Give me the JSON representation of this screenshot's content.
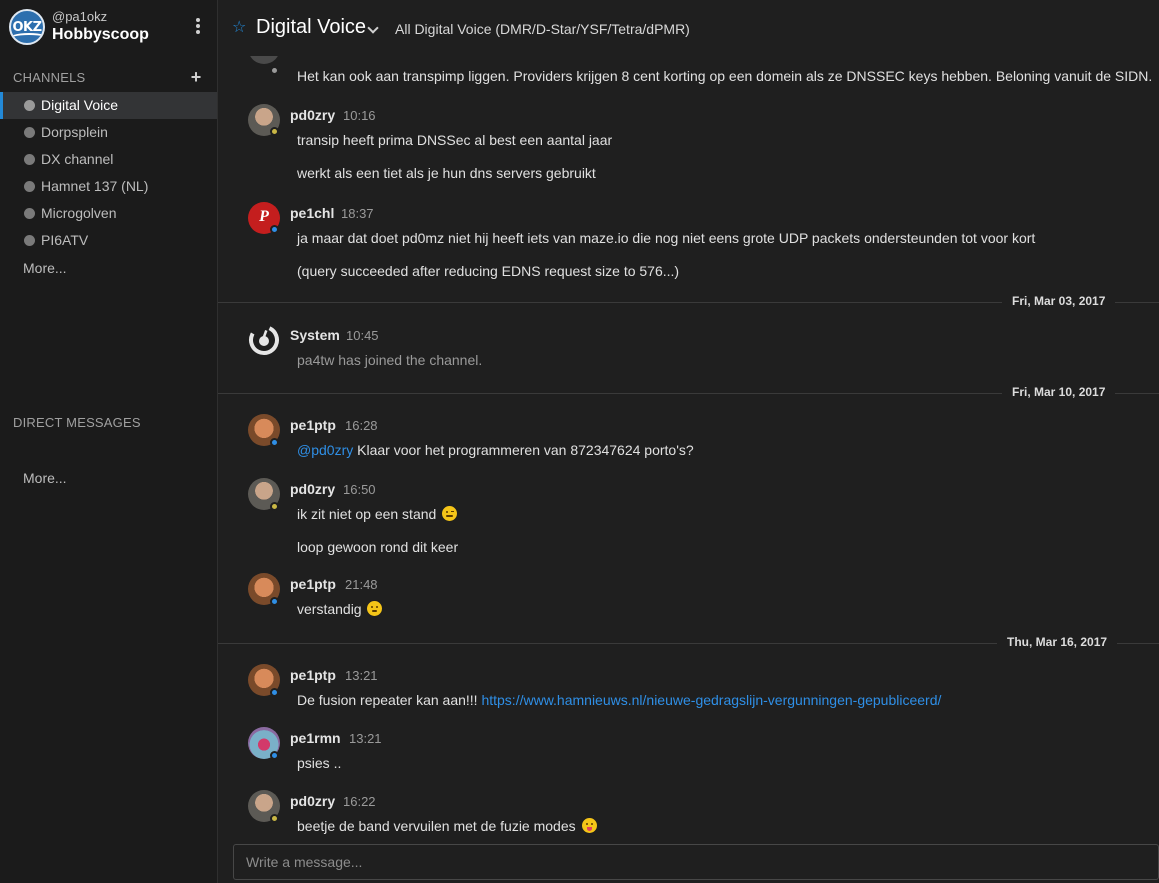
{
  "team": {
    "user": "@pa1okz",
    "name": "Hobbyscoop",
    "logo_text": "OKZ"
  },
  "sidebar": {
    "channels_title": "CHANNELS",
    "channels": [
      {
        "label": "Digital Voice",
        "active": true
      },
      {
        "label": "Dorpsplein"
      },
      {
        "label": "DX channel"
      },
      {
        "label": "Hamnet 137 (NL)"
      },
      {
        "label": "Microgolven"
      },
      {
        "label": "PI6ATV"
      }
    ],
    "channels_more": "More...",
    "dm_title": "DIRECT MESSAGES",
    "dm_more": "More..."
  },
  "header": {
    "channel_title": "Digital Voice",
    "purpose": "All Digital Voice (DMR/D-Star/YSF/Tetra/dPMR)"
  },
  "messages": [
    {
      "text": "Het kan ook aan transpimp liggen. Providers krijgen 8 cent korting op een domein als ze DNSSEC keys hebben. Beloning vanuit de SIDN."
    },
    {
      "author": "pd0zry",
      "time": "10:16",
      "lines": [
        "transip heeft prima DNSSec al best een aantal jaar",
        "werkt als een tiet als je hun dns servers gebruikt"
      ]
    },
    {
      "author": "pe1chl",
      "time": "18:37",
      "lines": [
        "ja maar dat doet pd0mz niet hij heeft iets van maze.io die nog niet eens grote UDP packets ondersteunden tot voor kort",
        "(query succeeded after reducing EDNS request size to 576...)"
      ]
    },
    {
      "author": "System",
      "time": "10:45",
      "lines": [
        "pa4tw has joined the channel."
      ]
    },
    {
      "author": "pe1ptp",
      "time": "16:28",
      "mention": "@pd0zry",
      "text": " Klaar voor het programmeren van 872347624 porto's?"
    },
    {
      "author": "pd0zry",
      "time": "16:50",
      "lines": [
        "ik zit niet op een stand",
        "loop gewoon rond dit keer"
      ]
    },
    {
      "author": "pe1ptp",
      "time": "21:48",
      "text": "verstandig"
    },
    {
      "author": "pe1ptp",
      "time": "13:21",
      "text": "De fusion repeater kan aan!!! ",
      "link": "https://www.hamnieuws.nl/nieuwe-gedragslijn-vergunningen-gepubliceerd/"
    },
    {
      "author": "pe1rmn",
      "time": "13:21",
      "text": "psies .."
    },
    {
      "author": "pd0zry",
      "time": "16:22",
      "text": "beetje de band vervuilen met de fuzie modes"
    }
  ],
  "date_separators": [
    "Fri, Mar 03, 2017",
    "Fri, Mar 10, 2017",
    "Thu, Mar 16, 2017"
  ],
  "input": {
    "placeholder": "Write a message..."
  },
  "colors": {
    "accent": "#2389d7",
    "link": "#2f8fe6",
    "background": "#1f1f1f",
    "sidebar": "#1b1b1b",
    "online": "#2f8fe6",
    "away": "#c9b745"
  },
  "icons": [
    "star-icon",
    "chevron-down-icon",
    "kebab-menu-icon",
    "plus-icon",
    "globe-icon"
  ]
}
